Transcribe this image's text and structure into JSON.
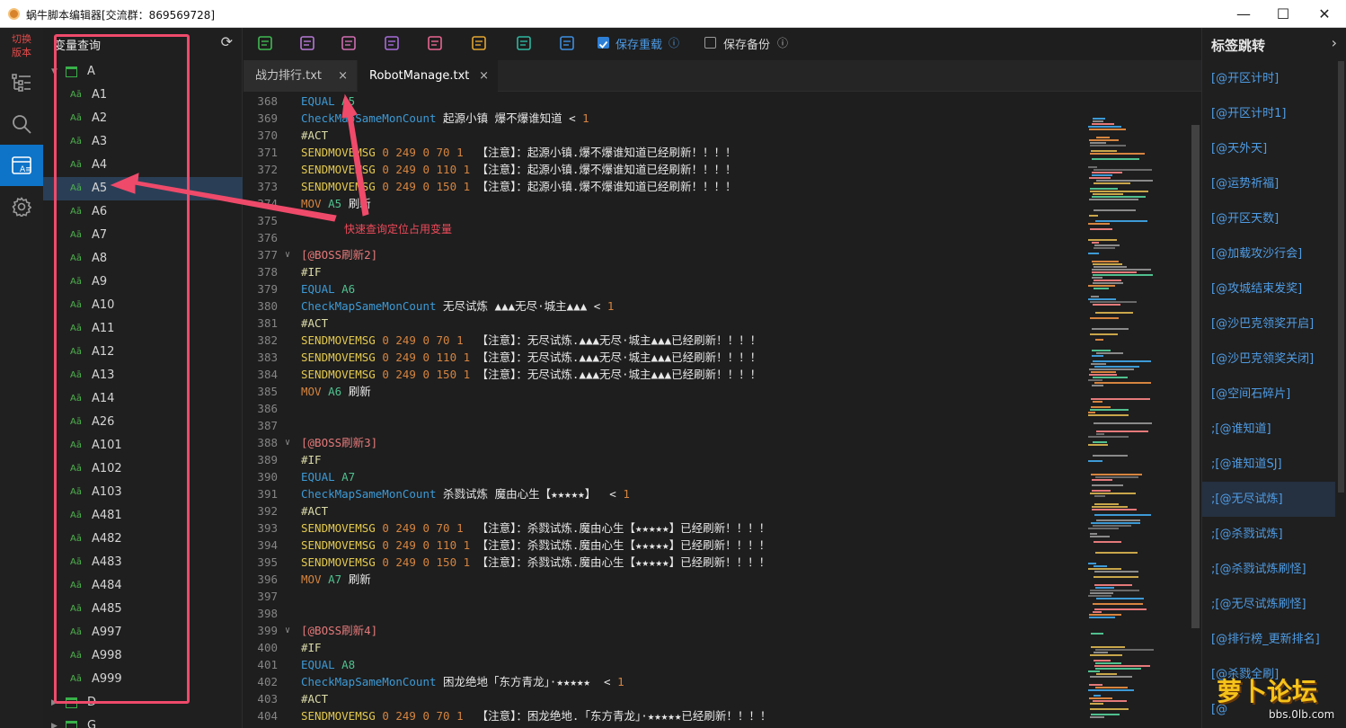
{
  "window": {
    "title": "蜗牛脚本编辑器[交流群：869569728]",
    "minimize": "—",
    "maximize": "☐",
    "close": "✕"
  },
  "activity_bar": {
    "switch_label": "切换\n版本",
    "items": [
      {
        "icon": "tree-list-icon"
      },
      {
        "icon": "search-icon"
      },
      {
        "icon": "variable-icon",
        "active": true
      },
      {
        "icon": "gear-icon"
      }
    ]
  },
  "variable_panel": {
    "title": "变量查询",
    "groups": [
      {
        "label": "A",
        "expanded": true,
        "items": [
          "A1",
          "A2",
          "A3",
          "A4",
          "A5",
          "A6",
          "A7",
          "A8",
          "A9",
          "A10",
          "A11",
          "A12",
          "A13",
          "A14",
          "A26",
          "A101",
          "A102",
          "A103",
          "A481",
          "A482",
          "A483",
          "A484",
          "A485",
          "A997",
          "A998",
          "A999"
        ],
        "selected": "A5"
      },
      {
        "label": "D",
        "expanded": false
      },
      {
        "label": "G",
        "expanded": false
      }
    ],
    "var_icon_text": "Aā"
  },
  "toolbar": {
    "icons": [
      {
        "name": "save-icon",
        "color": "#3fb950"
      },
      {
        "name": "edit-doc-icon",
        "color": "#b678d6"
      },
      {
        "name": "clear-doc-icon",
        "color": "#d06fb2"
      },
      {
        "name": "find-icon",
        "color": "#a66bd9"
      },
      {
        "name": "replace-icon",
        "color": "#e96591"
      },
      {
        "name": "qr-icon",
        "color": "#e3a532"
      },
      {
        "name": "upload-cloud-icon",
        "color": "#2eb6a0"
      },
      {
        "name": "folder-open-icon",
        "color": "#3d8ee0"
      }
    ],
    "save_reload_label": "保存重载",
    "save_reload_checked": true,
    "save_backup_label": "保存备份",
    "save_backup_checked": false
  },
  "tabs": [
    {
      "label": "战力排行.txt",
      "active": false
    },
    {
      "label": "RobotManage.txt",
      "active": true
    }
  ],
  "code_lines": [
    {
      "n": "368",
      "t": [
        [
          "k-blue",
          "EQUAL "
        ],
        [
          "k-var",
          "A5"
        ]
      ]
    },
    {
      "n": "369",
      "t": [
        [
          "k-blue",
          "CheckMapSameMonCount "
        ],
        [
          "k-str",
          "起源小镇 爆不爆谁知道 < "
        ],
        [
          "k-num",
          "1"
        ]
      ]
    },
    {
      "n": "370",
      "t": [
        [
          "k-hash",
          "#ACT"
        ]
      ]
    },
    {
      "n": "371",
      "t": [
        [
          "k-yel",
          "SENDMOVEMSG "
        ],
        [
          "k-num",
          "0 249 0 70 1  "
        ],
        [
          "k-str",
          "【注意】：起源小镇.爆不爆谁知道已经刷新！！！！"
        ]
      ]
    },
    {
      "n": "372",
      "t": [
        [
          "k-yel",
          "SENDMOVEMSG "
        ],
        [
          "k-num",
          "0 249 0 110 1 "
        ],
        [
          "k-str",
          "【注意】：起源小镇.爆不爆谁知道已经刷新！！！！"
        ]
      ]
    },
    {
      "n": "373",
      "t": [
        [
          "k-yel",
          "SENDMOVEMSG "
        ],
        [
          "k-num",
          "0 249 0 150 1 "
        ],
        [
          "k-str",
          "【注意】：起源小镇.爆不爆谁知道已经刷新！！！！"
        ]
      ]
    },
    {
      "n": "374",
      "t": [
        [
          "k-num",
          "MOV "
        ],
        [
          "k-var",
          "A5 "
        ],
        [
          "k-str",
          "刷新"
        ]
      ]
    },
    {
      "n": "375",
      "t": []
    },
    {
      "n": "376",
      "t": []
    },
    {
      "n": "377",
      "f": true,
      "t": [
        [
          "k-sec",
          "[@BOSS刷新2]"
        ]
      ]
    },
    {
      "n": "378",
      "t": [
        [
          "k-hash",
          "#IF"
        ]
      ]
    },
    {
      "n": "379",
      "t": [
        [
          "k-blue",
          "EQUAL "
        ],
        [
          "k-var",
          "A6"
        ]
      ]
    },
    {
      "n": "380",
      "t": [
        [
          "k-blue",
          "CheckMapSameMonCount "
        ],
        [
          "k-str",
          "无尽试炼 ▲▲▲无尽·城主▲▲▲ < "
        ],
        [
          "k-num",
          "1"
        ]
      ]
    },
    {
      "n": "381",
      "t": [
        [
          "k-hash",
          "#ACT"
        ]
      ]
    },
    {
      "n": "382",
      "t": [
        [
          "k-yel",
          "SENDMOVEMSG "
        ],
        [
          "k-num",
          "0 249 0 70 1  "
        ],
        [
          "k-str",
          "【注意】：无尽试炼.▲▲▲无尽·城主▲▲▲已经刷新！！！！"
        ]
      ]
    },
    {
      "n": "383",
      "t": [
        [
          "k-yel",
          "SENDMOVEMSG "
        ],
        [
          "k-num",
          "0 249 0 110 1 "
        ],
        [
          "k-str",
          "【注意】：无尽试炼.▲▲▲无尽·城主▲▲▲已经刷新！！！！"
        ]
      ]
    },
    {
      "n": "384",
      "t": [
        [
          "k-yel",
          "SENDMOVEMSG "
        ],
        [
          "k-num",
          "0 249 0 150 1 "
        ],
        [
          "k-str",
          "【注意】：无尽试炼.▲▲▲无尽·城主▲▲▲已经刷新！！！！"
        ]
      ]
    },
    {
      "n": "385",
      "t": [
        [
          "k-num",
          "MOV "
        ],
        [
          "k-var",
          "A6 "
        ],
        [
          "k-str",
          "刷新"
        ]
      ]
    },
    {
      "n": "386",
      "t": []
    },
    {
      "n": "387",
      "t": []
    },
    {
      "n": "388",
      "f": true,
      "t": [
        [
          "k-sec",
          "[@BOSS刷新3]"
        ]
      ]
    },
    {
      "n": "389",
      "t": [
        [
          "k-hash",
          "#IF"
        ]
      ]
    },
    {
      "n": "390",
      "t": [
        [
          "k-blue",
          "EQUAL "
        ],
        [
          "k-var",
          "A7"
        ]
      ]
    },
    {
      "n": "391",
      "t": [
        [
          "k-blue",
          "CheckMapSameMonCount "
        ],
        [
          "k-str",
          "杀戮试炼 魔由心生【★★★★★】  < "
        ],
        [
          "k-num",
          "1"
        ]
      ]
    },
    {
      "n": "392",
      "t": [
        [
          "k-hash",
          "#ACT"
        ]
      ]
    },
    {
      "n": "393",
      "t": [
        [
          "k-yel",
          "SENDMOVEMSG "
        ],
        [
          "k-num",
          "0 249 0 70 1  "
        ],
        [
          "k-str",
          "【注意】：杀戮试炼.魔由心生【★★★★★】已经刷新！！！！"
        ]
      ]
    },
    {
      "n": "394",
      "t": [
        [
          "k-yel",
          "SENDMOVEMSG "
        ],
        [
          "k-num",
          "0 249 0 110 1 "
        ],
        [
          "k-str",
          "【注意】：杀戮试炼.魔由心生【★★★★★】已经刷新！！！！"
        ]
      ]
    },
    {
      "n": "395",
      "t": [
        [
          "k-yel",
          "SENDMOVEMSG "
        ],
        [
          "k-num",
          "0 249 0 150 1 "
        ],
        [
          "k-str",
          "【注意】：杀戮试炼.魔由心生【★★★★★】已经刷新！！！！"
        ]
      ]
    },
    {
      "n": "396",
      "t": [
        [
          "k-num",
          "MOV "
        ],
        [
          "k-var",
          "A7 "
        ],
        [
          "k-str",
          "刷新"
        ]
      ]
    },
    {
      "n": "397",
      "t": []
    },
    {
      "n": "398",
      "t": []
    },
    {
      "n": "399",
      "f": true,
      "t": [
        [
          "k-sec",
          "[@BOSS刷新4]"
        ]
      ]
    },
    {
      "n": "400",
      "t": [
        [
          "k-hash",
          "#IF"
        ]
      ]
    },
    {
      "n": "401",
      "t": [
        [
          "k-blue",
          "EQUAL "
        ],
        [
          "k-var",
          "A8"
        ]
      ]
    },
    {
      "n": "402",
      "t": [
        [
          "k-blue",
          "CheckMapSameMonCount "
        ],
        [
          "k-str",
          "困龙绝地「东方青龙」·★★★★★  < "
        ],
        [
          "k-num",
          "1"
        ]
      ]
    },
    {
      "n": "403",
      "t": [
        [
          "k-hash",
          "#ACT"
        ]
      ]
    },
    {
      "n": "404",
      "t": [
        [
          "k-yel",
          "SENDMOVEMSG "
        ],
        [
          "k-num",
          "0 249 0 70 1  "
        ],
        [
          "k-str",
          "【注意】：困龙绝地.「东方青龙」·★★★★★已经刷新！！！！"
        ]
      ]
    }
  ],
  "annotation": "快速查询定位占用变量",
  "bookmark_panel": {
    "title": "标签跳转",
    "items": [
      "[@开区计时]",
      "[@开区计时1]",
      "[@天外天]",
      "[@运势祈福]",
      "[@开区天数]",
      "[@加载攻沙行会]",
      "[@攻城结束发奖]",
      "[@沙巴克领奖开启]",
      "[@沙巴克领奖关闭]",
      "[@空间石碎片]",
      ";[@谁知道]",
      ";[@谁知道SJ]",
      ";[@无尽试炼]",
      ";[@杀戮试炼]",
      ";[@杀戮试炼刷怪]",
      ";[@无尽试炼刷怪]",
      "[@排行榜_更新排名]",
      "[@杀戮全刷]",
      "[@"
    ],
    "selected_index": 12
  },
  "watermark": {
    "big": "萝卜论坛",
    "small": "bbs.0lb.com"
  }
}
